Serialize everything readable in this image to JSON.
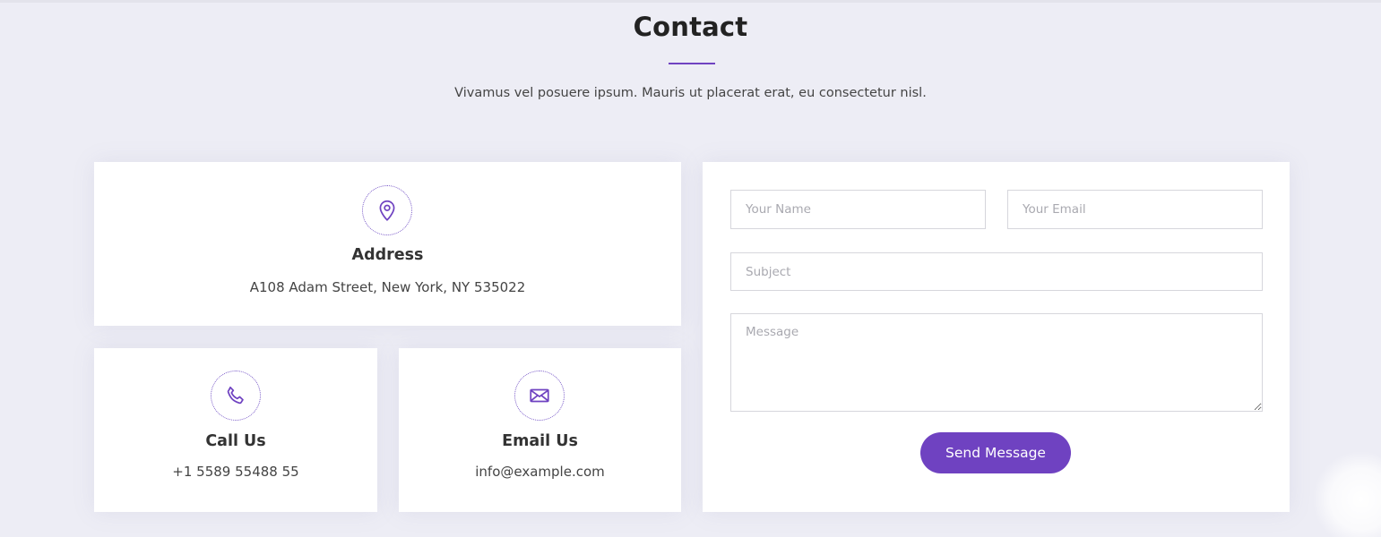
{
  "section": {
    "title": "Contact",
    "subtitle": "Vivamus vel posuere ipsum. Mauris ut placerat erat, eu consectetur nisl."
  },
  "address": {
    "icon": "map-pin-icon",
    "heading": "Address",
    "text": "A108 Adam Street, New York, NY 535022"
  },
  "call": {
    "icon": "phone-icon",
    "heading": "Call Us",
    "text": "+1 5589 55488 55"
  },
  "email": {
    "icon": "envelope-icon",
    "heading": "Email Us",
    "text": "info@example.com"
  },
  "form": {
    "name_placeholder": "Your Name",
    "email_placeholder": "Your Email",
    "subject_placeholder": "Subject",
    "message_placeholder": "Message",
    "submit_label": "Send Message"
  },
  "colors": {
    "accent": "#6f42c1",
    "background": "#ededf5",
    "card": "#ffffff"
  }
}
